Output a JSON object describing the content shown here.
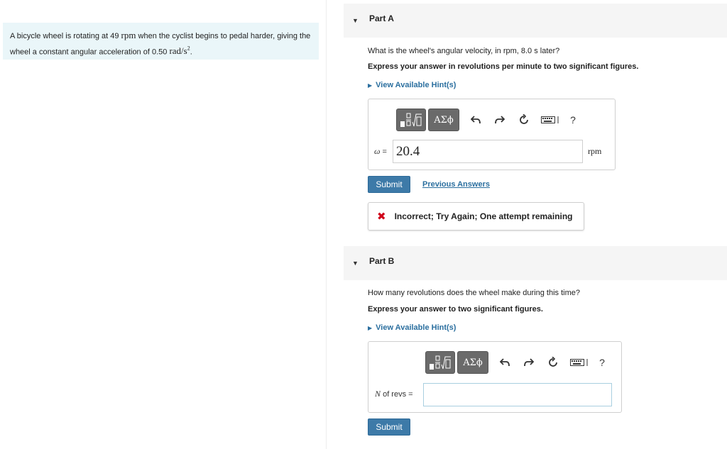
{
  "problem": {
    "text_1": "A bicycle wheel is rotating at 49 ",
    "unit_rpm": "rpm",
    "text_2": " when the cyclist begins to pedal harder, giving the wheel a constant angular acceleration of 0.50 ",
    "unit_acc": "rad/s",
    "unit_acc_exp": "2",
    "text_3": "."
  },
  "toolbar": {
    "greek_label": "ΑΣϕ",
    "help_label": "?"
  },
  "partA": {
    "title": "Part A",
    "question": "What is the wheel's angular velocity, in rpm, 8.0 s later?",
    "instruction": "Express your answer in revolutions per minute to two significant figures.",
    "hint": "View Available Hint(s)",
    "var_label": "ω",
    "eq": " =",
    "value": "20.4",
    "unit": "rpm",
    "submit": "Submit",
    "previous_answers": "Previous Answers",
    "feedback": "Incorrect; Try Again; One attempt remaining"
  },
  "partB": {
    "title": "Part B",
    "question": "How many revolutions does the wheel make during this time?",
    "instruction": "Express your answer to two significant figures.",
    "hint": "View Available Hint(s)",
    "var_label": "N",
    "var_suffix": " of revs =",
    "value": "",
    "submit": "Submit"
  }
}
